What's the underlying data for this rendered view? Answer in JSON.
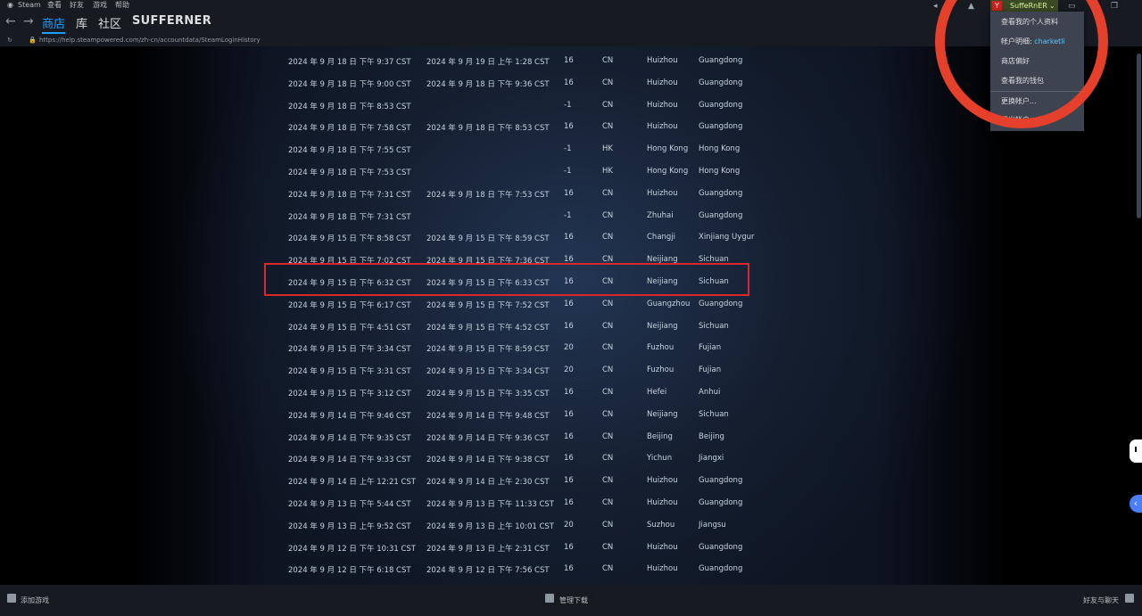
{
  "menubar": {
    "app": "Steam",
    "view": "查看",
    "friends": "好友",
    "games": "游戏",
    "help": "帮助"
  },
  "nav": {
    "store": "商店",
    "library": "库",
    "community": "社区",
    "user": "SUFFERNER"
  },
  "url": "https://help.steampowered.com/zh-cn/accountdata/SteamLoginHistory",
  "account": {
    "name": "SuffeRnER",
    "menu": {
      "profile": "查看我的个人资料",
      "details_label": "帐户明细:",
      "details_value": "charketli",
      "preferences": "商店偏好",
      "wallet": "查看我的钱包",
      "switch": "更换帐户...",
      "logout": "退出帐户..."
    }
  },
  "rows": [
    [
      "2024 年 9 月 18 日 下午 9:37 CST",
      "2024 年 9 月 19 日 上午 1:28 CST",
      "16",
      "CN",
      "Huizhou",
      "Guangdong"
    ],
    [
      "2024 年 9 月 18 日 下午 9:00 CST",
      "2024 年 9 月 18 日 下午 9:36 CST",
      "16",
      "CN",
      "Huizhou",
      "Guangdong"
    ],
    [
      "2024 年 9 月 18 日 下午 8:53 CST",
      "",
      "-1",
      "CN",
      "Huizhou",
      "Guangdong"
    ],
    [
      "2024 年 9 月 18 日 下午 7:58 CST",
      "2024 年 9 月 18 日 下午 8:53 CST",
      "16",
      "CN",
      "Huizhou",
      "Guangdong"
    ],
    [
      "2024 年 9 月 18 日 下午 7:55 CST",
      "",
      "-1",
      "HK",
      "Hong Kong",
      "Hong Kong"
    ],
    [
      "2024 年 9 月 18 日 下午 7:53 CST",
      "",
      "-1",
      "HK",
      "Hong Kong",
      "Hong Kong"
    ],
    [
      "2024 年 9 月 18 日 下午 7:31 CST",
      "2024 年 9 月 18 日 下午 7:53 CST",
      "16",
      "CN",
      "Huizhou",
      "Guangdong"
    ],
    [
      "2024 年 9 月 18 日 下午 7:31 CST",
      "",
      "-1",
      "CN",
      "Zhuhai",
      "Guangdong"
    ],
    [
      "2024 年 9 月 15 日 下午 8:58 CST",
      "2024 年 9 月 15 日 下午 8:59 CST",
      "16",
      "CN",
      "Changji",
      "Xinjiang Uygur"
    ],
    [
      "2024 年 9 月 15 日 下午 7:02 CST",
      "2024 年 9 月 15 日 下午 7:36 CST",
      "16",
      "CN",
      "Neijiang",
      "Sichuan"
    ],
    [
      "2024 年 9 月 15 日 下午 6:32 CST",
      "2024 年 9 月 15 日 下午 6:33 CST",
      "16",
      "CN",
      "Neijiang",
      "Sichuan"
    ],
    [
      "2024 年 9 月 15 日 下午 6:17 CST",
      "2024 年 9 月 15 日 下午 7:52 CST",
      "16",
      "CN",
      "Guangzhou",
      "Guangdong"
    ],
    [
      "2024 年 9 月 15 日 下午 4:51 CST",
      "2024 年 9 月 15 日 下午 4:52 CST",
      "16",
      "CN",
      "Neijiang",
      "Sichuan"
    ],
    [
      "2024 年 9 月 15 日 下午 3:34 CST",
      "2024 年 9 月 15 日 下午 8:59 CST",
      "20",
      "CN",
      "Fuzhou",
      "Fujian"
    ],
    [
      "2024 年 9 月 15 日 下午 3:31 CST",
      "2024 年 9 月 15 日 下午 3:34 CST",
      "20",
      "CN",
      "Fuzhou",
      "Fujian"
    ],
    [
      "2024 年 9 月 15 日 下午 3:12 CST",
      "2024 年 9 月 15 日 下午 3:35 CST",
      "16",
      "CN",
      "Hefei",
      "Anhui"
    ],
    [
      "2024 年 9 月 14 日 下午 9:46 CST",
      "2024 年 9 月 14 日 下午 9:48 CST",
      "16",
      "CN",
      "Neijiang",
      "Sichuan"
    ],
    [
      "2024 年 9 月 14 日 下午 9:35 CST",
      "2024 年 9 月 14 日 下午 9:36 CST",
      "16",
      "CN",
      "Beijing",
      "Beijing"
    ],
    [
      "2024 年 9 月 14 日 下午 9:33 CST",
      "2024 年 9 月 14 日 下午 9:38 CST",
      "16",
      "CN",
      "Yichun",
      "Jiangxi"
    ],
    [
      "2024 年 9 月 14 日 上午 12:21 CST",
      "2024 年 9 月 14 日 上午 2:30 CST",
      "16",
      "CN",
      "Huizhou",
      "Guangdong"
    ],
    [
      "2024 年 9 月 13 日 下午 5:44 CST",
      "2024 年 9 月 13 日 下午 11:33 CST",
      "16",
      "CN",
      "Huizhou",
      "Guangdong"
    ],
    [
      "2024 年 9 月 13 日 上午 9:52 CST",
      "2024 年 9 月 13 日 上午 10:01 CST",
      "20",
      "CN",
      "Suzhou",
      "Jiangsu"
    ],
    [
      "2024 年 9 月 12 日 下午 10:31 CST",
      "2024 年 9 月 13 日 上午 2:31 CST",
      "16",
      "CN",
      "Huizhou",
      "Guangdong"
    ],
    [
      "2024 年 9 月 12 日 下午 6:18 CST",
      "2024 年 9 月 12 日 下午 7:56 CST",
      "16",
      "CN",
      "Huizhou",
      "Guangdong"
    ]
  ],
  "footer": {
    "add_game": "添加游戏",
    "downloads": "管理下载",
    "friends_chat": "好友与聊天"
  }
}
